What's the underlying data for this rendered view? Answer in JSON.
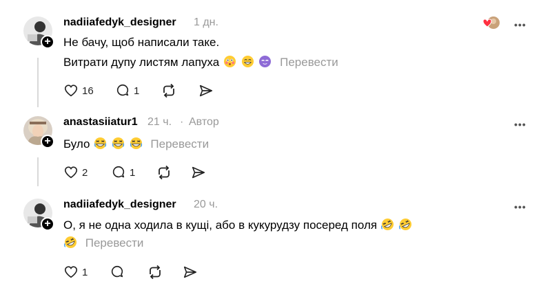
{
  "posts": [
    {
      "username": "nadiiafedyk_designer",
      "time": "1 дн.",
      "lines": [
        "Не бачу, щоб написали таке.",
        "Витрати дупу листям лапуха"
      ],
      "emojis_line2": [
        "flushed-face-emoji",
        "grinning-face-emoji",
        "disguised-face-emoji"
      ],
      "translate": "Перевести",
      "likes": "16",
      "replies": "1",
      "icons": [
        "heart-icon",
        "reply-icon",
        "repost-icon",
        "share-icon"
      ]
    },
    {
      "username": "anastasiiatur1",
      "time": "21 ч.",
      "separator": "·",
      "author_badge": "Автор",
      "lines": [
        "Було"
      ],
      "emojis": [
        "laughing-face-emoji",
        "laughing-face-emoji",
        "laughing-face-emoji"
      ],
      "translate": "Перевести",
      "likes": "2",
      "replies": "1"
    },
    {
      "username": "nadiiafedyk_designer",
      "time": "20 ч.",
      "lines": [
        "О, я не одна ходила в кущі, або в кукурудзу посеред поля"
      ],
      "emojis": [
        "rolling-laughing-emoji",
        "rolling-laughing-emoji",
        "rolling-laughing-emoji"
      ],
      "translate": "Перевести",
      "likes": "1",
      "replies": ""
    }
  ],
  "more_label": "•••",
  "plus_label": "+",
  "colors": {
    "muted": "#999999",
    "line": "#d9d9d9",
    "like_red": "#ff3040"
  }
}
